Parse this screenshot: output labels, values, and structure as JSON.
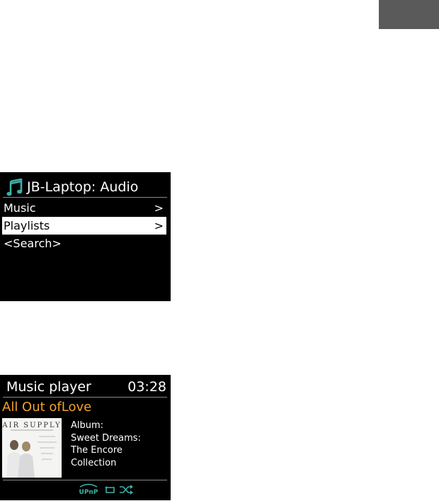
{
  "browser_screen": {
    "title": "JB-Laptop: Audio",
    "items": [
      {
        "label": "Music",
        "arrow": ">",
        "selected": false
      },
      {
        "label": "Playlists",
        "arrow": ">",
        "selected": true
      },
      {
        "label": "<Search>",
        "arrow": "",
        "selected": false
      }
    ]
  },
  "player_screen": {
    "title": "Music player",
    "time": "03:28",
    "song": "All Out ofLove",
    "album_lines": [
      "Album:",
      "Sweet Dreams:",
      "The Encore",
      "Collection"
    ],
    "album_art_text": "AIR SUPPLY",
    "status_icons": {
      "upnp_label": "UPnP",
      "repeat": "repeat-icon",
      "shuffle": "shuffle-icon"
    }
  },
  "colors": {
    "accent_teal": "#3fb0a8",
    "song_orange": "#f0a22a",
    "screen_bg": "#000000",
    "selected_bg": "#ffffff"
  }
}
